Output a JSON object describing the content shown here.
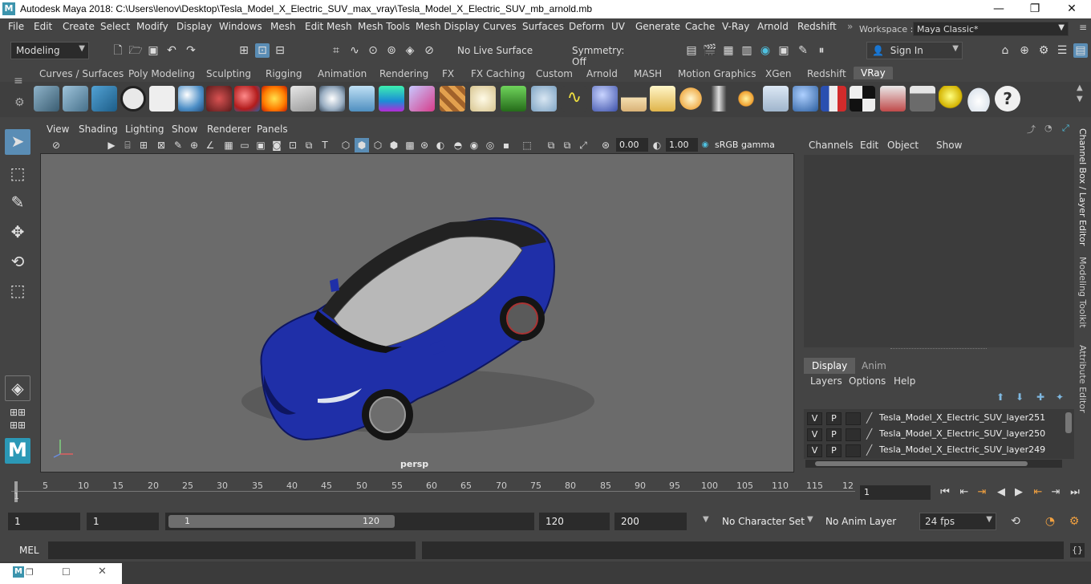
{
  "window": {
    "title": "Autodesk Maya 2018: C:\\Users\\lenov\\Desktop\\Tesla_Model_X_Electric_SUV_max_vray\\Tesla_Model_X_Electric_SUV_mb_arnold.mb",
    "logo_letter": "M",
    "min_glyph": "—",
    "max_glyph": "❐",
    "close_glyph": "✕"
  },
  "menu": [
    "File",
    "Edit",
    "Create",
    "Select",
    "Modify",
    "Display",
    "Windows",
    "Mesh",
    "Edit Mesh",
    "Mesh Tools",
    "Mesh Display",
    "Curves",
    "Surfaces",
    "Deform",
    "UV",
    "Generate",
    "Cache",
    "V-Ray",
    "Arnold",
    "Redshift"
  ],
  "workspace": {
    "label": "Workspace :",
    "value": "Maya Classic*"
  },
  "statusline": {
    "mode": "Modeling",
    "live_surface": "No Live Surface",
    "symmetry": "Symmetry: Off",
    "sign_in": "Sign In"
  },
  "shelf_tabs": [
    "Curves / Surfaces",
    "Poly Modeling",
    "Sculpting",
    "Rigging",
    "Animation",
    "Rendering",
    "FX",
    "FX Caching",
    "Custom",
    "Arnold",
    "MASH",
    "Motion Graphics",
    "XGen",
    "Redshift",
    "VRay"
  ],
  "shelf_tab_active": "VRay",
  "viewport": {
    "menus": [
      "View",
      "Shading",
      "Lighting",
      "Show",
      "Renderer",
      "Panels"
    ],
    "exposure": "0.00",
    "gamma": "1.00",
    "color_space": "sRGB gamma",
    "camera_label": "persp",
    "car_color": "#1f2fa8"
  },
  "channel_box": {
    "menus": [
      "Channels",
      "Edit",
      "Object",
      "Show"
    ]
  },
  "layer_editor": {
    "tabs": [
      "Display",
      "Anim"
    ],
    "menus": [
      "Layers",
      "Options",
      "Help"
    ],
    "layers": [
      {
        "v": "V",
        "p": "P",
        "name": "Tesla_Model_X_Electric_SUV_layer251"
      },
      {
        "v": "V",
        "p": "P",
        "name": "Tesla_Model_X_Electric_SUV_layer250"
      },
      {
        "v": "V",
        "p": "P",
        "name": "Tesla_Model_X_Electric_SUV_layer249"
      }
    ]
  },
  "side_tabs": [
    "Channel Box / Layer Editor",
    "Modeling Toolkit",
    "Attribute Editor"
  ],
  "timeline": {
    "ticks": [
      "1",
      "5",
      "10",
      "15",
      "20",
      "25",
      "30",
      "35",
      "40",
      "45",
      "50",
      "55",
      "60",
      "65",
      "70",
      "75",
      "80",
      "85",
      "90",
      "95",
      "100",
      "105",
      "110",
      "115",
      "12"
    ],
    "current_frame": "1"
  },
  "range": {
    "start": "1",
    "playback_start": "1",
    "slider_start": "1",
    "slider_end": "120",
    "playback_end": "120",
    "end": "200",
    "character_set": "No Character Set",
    "anim_layer": "No Anim Layer",
    "fps": "24 fps"
  },
  "command_line": {
    "label": "MEL"
  }
}
